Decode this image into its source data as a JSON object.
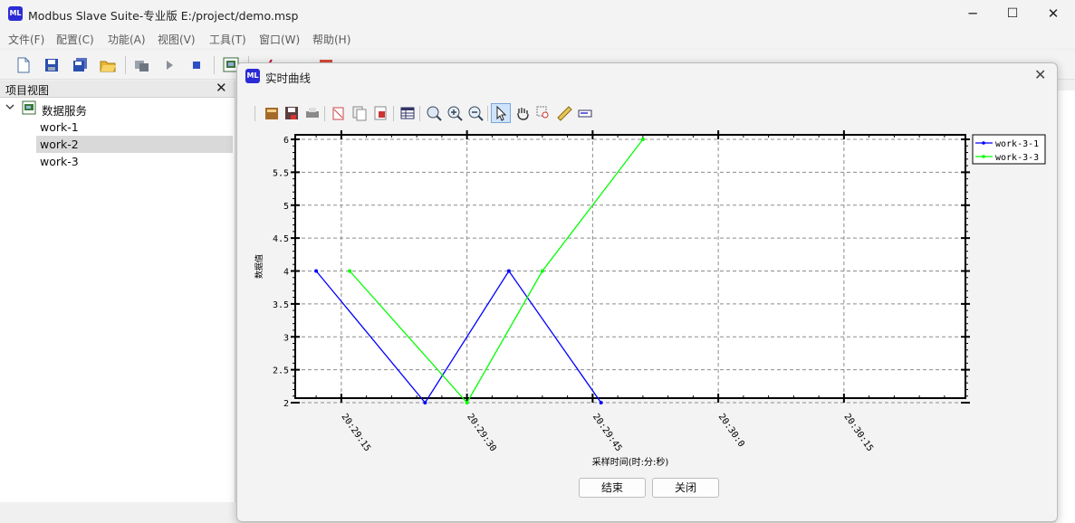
{
  "window": {
    "icon_text": "ML",
    "title": "Modbus Slave Suite-专业版 E:/project/demo.msp",
    "minimize": "─",
    "maximize": "☐",
    "close": "✕"
  },
  "menu": [
    "文件(F)",
    "配置(C)",
    "功能(A)",
    "视图(V)",
    "工具(T)",
    "窗口(W)",
    "帮助(H)"
  ],
  "toolbar_icons": [
    "new-file-icon",
    "save-icon",
    "save-all-icon",
    "open-folder-icon",
    "connect-icon",
    "run-icon",
    "stop-icon",
    "monitor-icon",
    "chart-icon",
    "alarm-icon"
  ],
  "project_panel": {
    "title": "项目视图",
    "close": "✕",
    "root": "数据服务",
    "children": [
      "work-1",
      "work-2",
      "work-3"
    ],
    "selected": "work-2"
  },
  "dialog": {
    "icon_text": "ML",
    "title": "实时曲线",
    "close": "✕",
    "buttons": {
      "end": "结束",
      "close": "关闭"
    },
    "plot_toolbar": [
      "open-icon",
      "save-icon",
      "print-icon",
      "cut-icon",
      "copy-icon",
      "export-icon",
      "table-icon",
      "zoom-fit-icon",
      "zoom-in-icon",
      "zoom-out-icon",
      "pointer-icon",
      "pan-hand-icon",
      "zoom-rect-icon",
      "ruler-icon",
      "legend-icon"
    ]
  },
  "chart_data": {
    "type": "line",
    "xlabel": "采样时间(时:分:秒)",
    "ylabel": "数据值",
    "x_ticks": [
      "20:29:15",
      "20:29:30",
      "20:29:45",
      "20:30:0",
      "20:30:15"
    ],
    "y_ticks": [
      "6",
      "5.5",
      "5",
      "4.5",
      "4",
      "3.5",
      "3",
      "2.5",
      "2"
    ],
    "ylim": [
      2,
      6
    ],
    "xlim_seconds_after_20_29_00": [
      9.5,
      89.5
    ],
    "grid": true,
    "legend_position": "top-right",
    "series": [
      {
        "name": "work-3-1",
        "color": "#0000ff",
        "x": [
          "20:29:12",
          "20:29:25",
          "20:29:35",
          "20:29:46"
        ],
        "y": [
          4,
          2,
          4,
          2
        ]
      },
      {
        "name": "work-3-3",
        "color": "#00ff00",
        "x": [
          "20:29:16",
          "20:29:30",
          "20:29:39",
          "20:29:51"
        ],
        "y": [
          4,
          2,
          4,
          6
        ]
      }
    ]
  }
}
